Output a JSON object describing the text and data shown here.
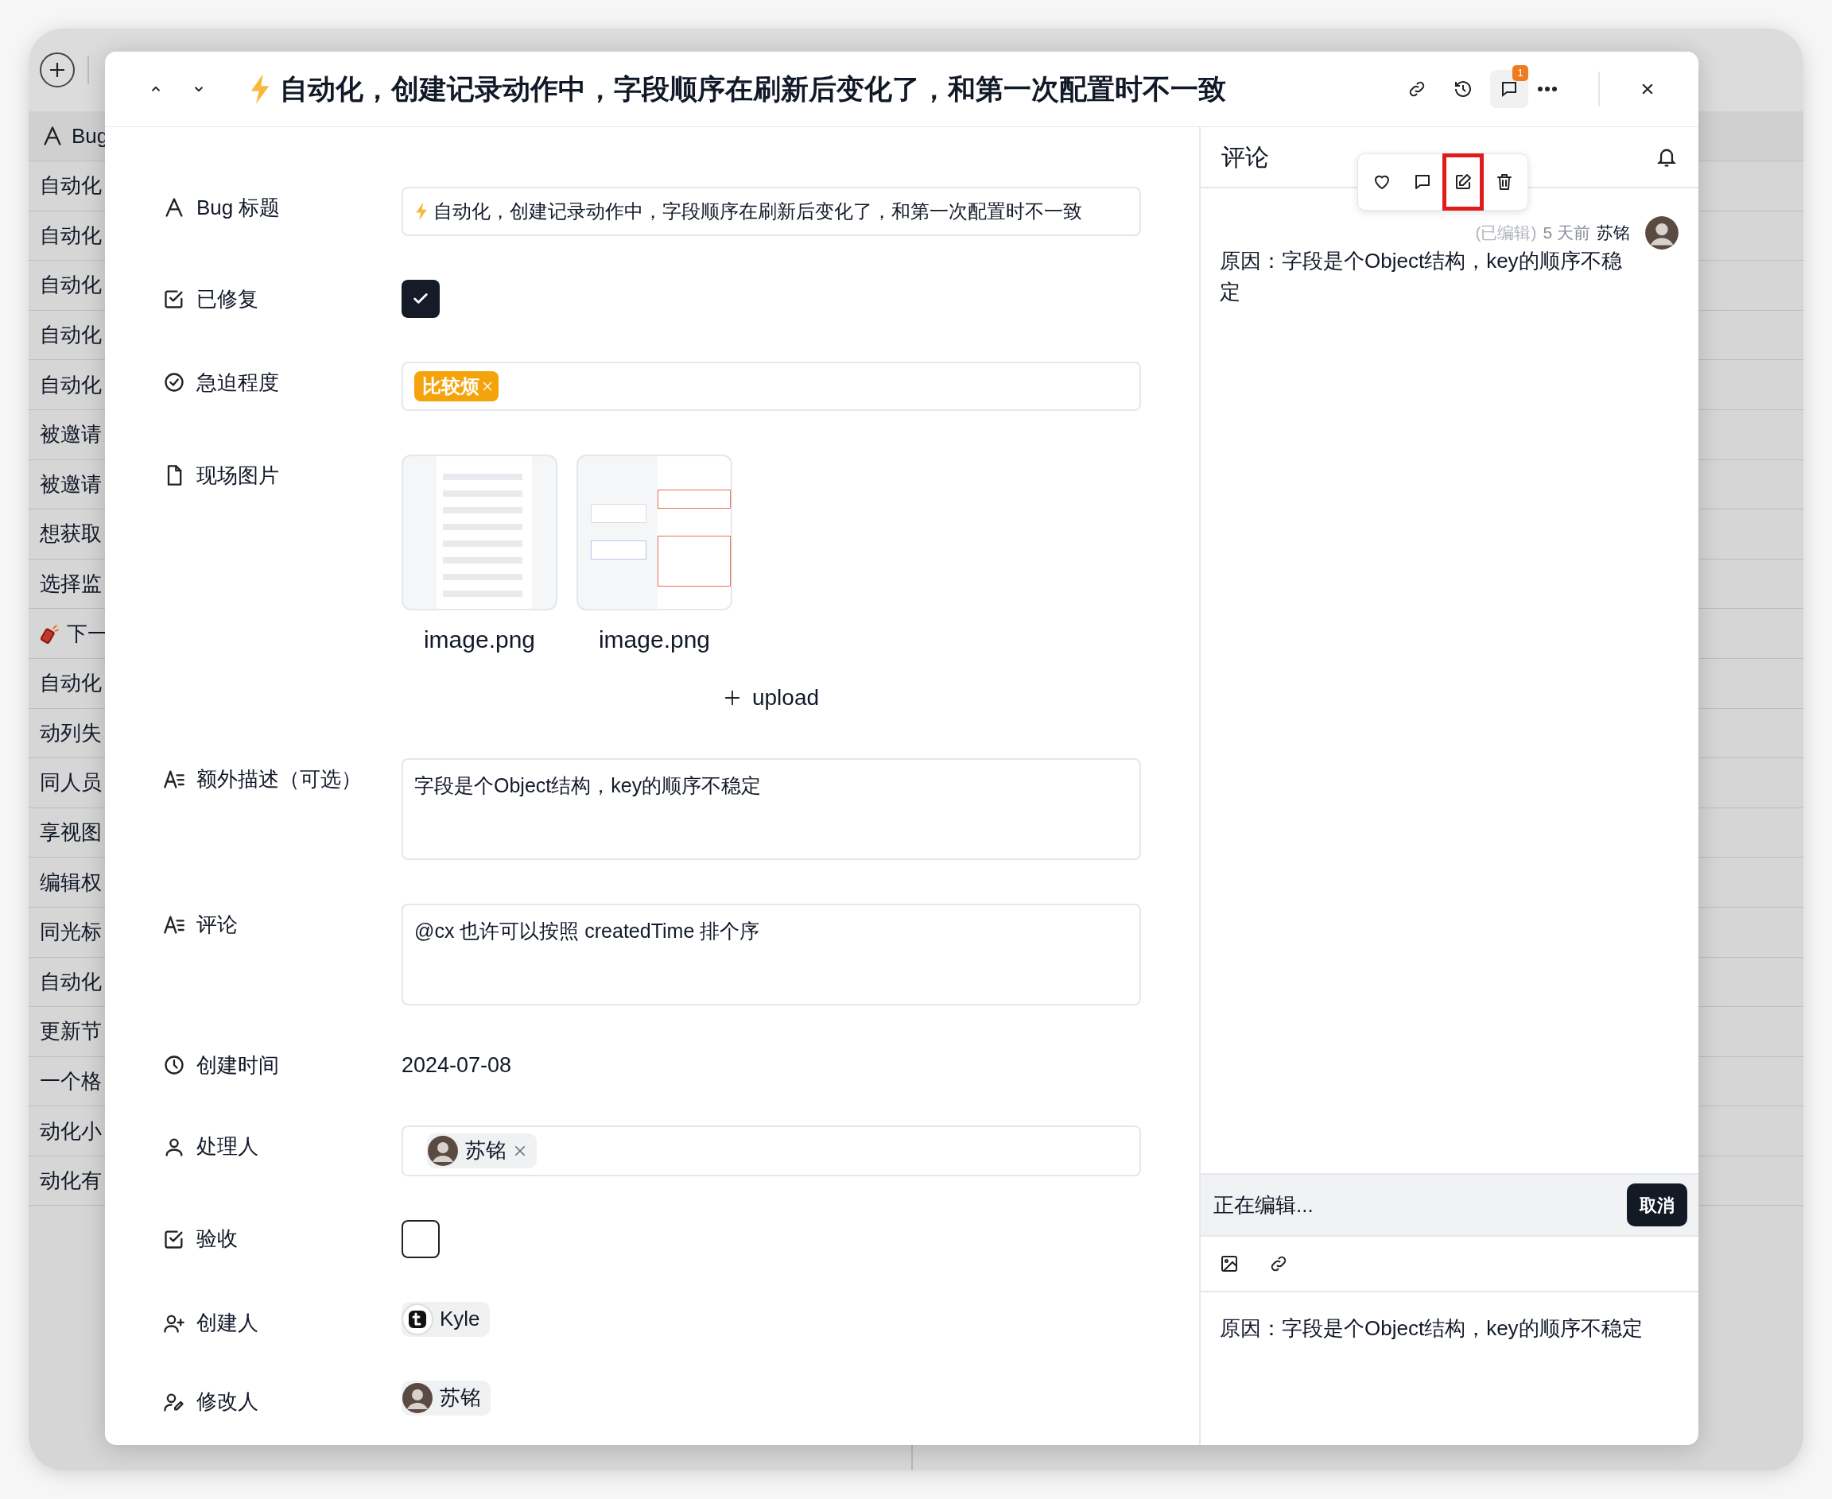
{
  "background_list": {
    "header": "Bug",
    "rows": [
      {
        "text": "自动化"
      },
      {
        "text": "自动化"
      },
      {
        "text": "自动化"
      },
      {
        "text": "自动化"
      },
      {
        "text": "自动化"
      },
      {
        "text": "被邀请"
      },
      {
        "text": "被邀请"
      },
      {
        "text": "想获取"
      },
      {
        "text": "选择监"
      },
      {
        "text": "下一",
        "kind": "flagged"
      },
      {
        "text": "自动化"
      },
      {
        "text": "动列失"
      },
      {
        "text": "同人员"
      },
      {
        "text": "享视图"
      },
      {
        "text": "编辑权"
      },
      {
        "text": "同光标"
      },
      {
        "text": "自动化"
      },
      {
        "text": "更新节"
      },
      {
        "text": "一个格"
      },
      {
        "text": "动化小"
      },
      {
        "text": "动化有"
      }
    ]
  },
  "record": {
    "title": "自动化，创建记录动作中，字段顺序在刷新后变化了，和第一次配置时不一致",
    "comment_badge": "1"
  },
  "form": {
    "fields": [
      {
        "kind": "text",
        "label": "Bug 标题",
        "value": "自动化，创建记录动作中，字段顺序在刷新后变化了，和第一次配置时不一致"
      },
      {
        "kind": "checkbox",
        "label": "已修复",
        "checked": true
      },
      {
        "kind": "tags",
        "label": "急迫程度",
        "tags": [
          {
            "label": "比较烦"
          }
        ]
      },
      {
        "kind": "attachments",
        "label": "现场图片",
        "files": [
          {
            "name": "image.png"
          },
          {
            "name": "image.png"
          }
        ],
        "upload": "upload"
      },
      {
        "kind": "textarea",
        "label": "额外描述（可选）",
        "value": "字段是个Object结构，key的顺序不稳定"
      },
      {
        "kind": "textarea",
        "label": "评论",
        "value": "@cx 也许可以按照 createdTime 排个序"
      },
      {
        "kind": "date",
        "label": "创建时间",
        "value": "2024-07-08"
      },
      {
        "kind": "users",
        "label": "处理人",
        "users": [
          {
            "name": "苏铭",
            "removable": true
          }
        ]
      },
      {
        "kind": "checkbox",
        "label": "验收",
        "checked": false
      },
      {
        "kind": "users",
        "label": "创建人",
        "users": [
          {
            "name": "Kyle",
            "removable": false,
            "kind": "logo"
          }
        ]
      },
      {
        "kind": "users",
        "label": "修改人",
        "users": [
          {
            "name": "苏铭",
            "removable": false
          }
        ]
      }
    ]
  },
  "comments_panel": {
    "title": "评论",
    "comment_actions": [
      {
        "kind": "like",
        "highlighted": false
      },
      {
        "kind": "reply",
        "highlighted": false
      },
      {
        "kind": "edit",
        "highlighted": true
      },
      {
        "kind": "delete",
        "highlighted": false
      }
    ],
    "comments": [
      {
        "edited": "(已编辑)",
        "time": "5 天前",
        "author": "苏铭",
        "body": "原因：字段是个Object结构，key的顺序不稳定"
      }
    ],
    "editing_bar": {
      "label": "正在编辑...",
      "cancel": "取消"
    },
    "editor": {
      "value": "原因：字段是个Object结构，key的顺序不稳定"
    }
  }
}
